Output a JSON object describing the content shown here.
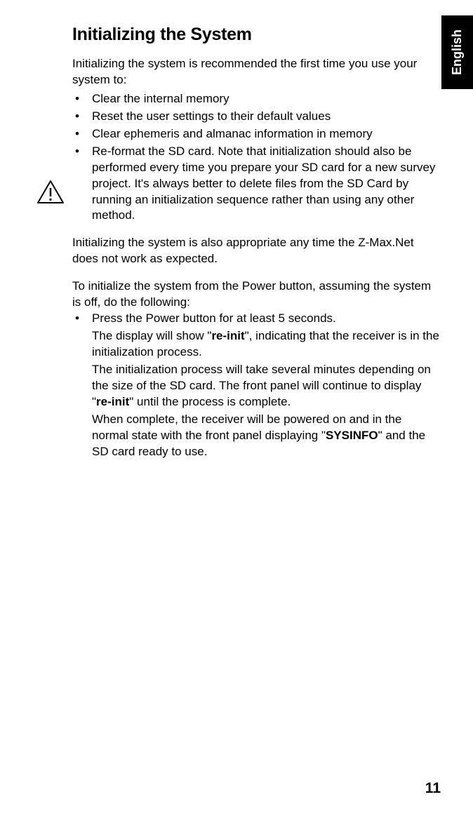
{
  "languageTab": "English",
  "heading": "Initializing the System",
  "intro": "Initializing the system is recommended the first time you use your system to:",
  "bullets": [
    "Clear the internal memory",
    "Reset the user settings to their default values",
    "Clear ephemeris and almanac information in memory",
    "Re-format the SD card. Note that initialization should also be performed every time you prepare your SD card for a new survey project. It's always better to delete files from the SD Card by running an initialization sequence rather than using any other method."
  ],
  "para1": "Initializing the system is also appropriate any time the Z-Max.Net does not work as expected.",
  "para2": "To initialize the system from the Power button, assuming the system is off, do the following:",
  "step1": "Press the Power button for at least 5 seconds.",
  "sub1_prefix": "The display will show \"",
  "sub1_bold": "re-init",
  "sub1_suffix": "\", indicating that the receiver is in the initialization process.",
  "sub2_prefix": "The initialization process will take several minutes depending on the size of the SD card. The front panel will continue to display \"",
  "sub2_bold": "re-init",
  "sub2_suffix": "\" until the process is complete.",
  "sub3_prefix": "When complete, the receiver will be powered on and in the normal state with the front panel displaying \"",
  "sub3_bold": "SYSINFO",
  "sub3_suffix": "\" and the SD card ready to use.",
  "pageNumber": "11"
}
